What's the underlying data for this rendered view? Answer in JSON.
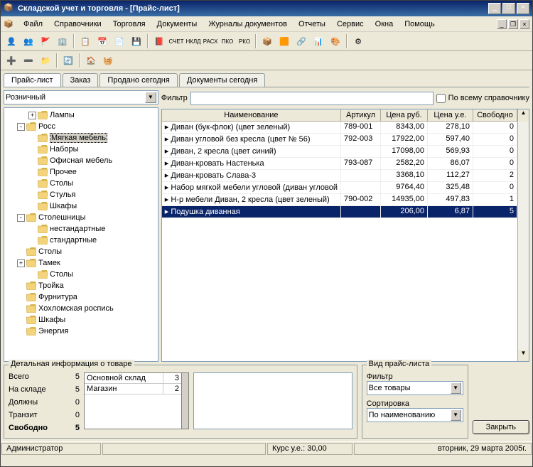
{
  "window": {
    "title": "Складской учет и торговля - [Прайс-лист]"
  },
  "menu": [
    "Файл",
    "Справочники",
    "Торговля",
    "Документы",
    "Журналы документов",
    "Отчеты",
    "Сервис",
    "Окна",
    "Помощь"
  ],
  "tabs": [
    {
      "label": "Прайс-лист",
      "active": true
    },
    {
      "label": "Заказ",
      "active": false
    },
    {
      "label": "Продано сегодня",
      "active": false
    },
    {
      "label": "Документы сегодня",
      "active": false
    }
  ],
  "price_type": "Розничный",
  "filter": {
    "label": "Фильтр",
    "value": "",
    "all_label": "По всему справочнику",
    "all_checked": false
  },
  "tree": [
    {
      "level": 2,
      "label": "Лампы",
      "toggle": "+"
    },
    {
      "level": 1,
      "label": "Росс",
      "toggle": "-"
    },
    {
      "level": 2,
      "label": "Мягкая мебель",
      "selected": true
    },
    {
      "level": 2,
      "label": "Наборы"
    },
    {
      "level": 2,
      "label": "Офисная мебель"
    },
    {
      "level": 2,
      "label": "Прочее"
    },
    {
      "level": 2,
      "label": "Столы"
    },
    {
      "level": 2,
      "label": "Стулья"
    },
    {
      "level": 2,
      "label": "Шкафы"
    },
    {
      "level": 1,
      "label": "Столешницы",
      "toggle": "-"
    },
    {
      "level": 2,
      "label": "нестандартные"
    },
    {
      "level": 2,
      "label": "стандартные"
    },
    {
      "level": 1,
      "label": "Столы"
    },
    {
      "level": 1,
      "label": "Тамек",
      "toggle": "+"
    },
    {
      "level": 2,
      "label": "Столы"
    },
    {
      "level": 1,
      "label": "Тройка"
    },
    {
      "level": 1,
      "label": "Фурнитура"
    },
    {
      "level": 1,
      "label": "Хохломская роспись"
    },
    {
      "level": 1,
      "label": "Шкафы"
    },
    {
      "level": 1,
      "label": "Энергия"
    }
  ],
  "grid": {
    "columns": [
      "Наименование",
      "Артикул",
      "Цена руб.",
      "Цена у.е.",
      "Свободно"
    ],
    "rows": [
      {
        "name": "Диван (бук-флок) (цвет зеленый)",
        "art": "789-001",
        "price": "8343,00",
        "priceu": "278,10",
        "free": "0"
      },
      {
        "name": "Диван угловой без кресла (цвет № 56)",
        "art": "792-003",
        "price": "17922,00",
        "priceu": "597,40",
        "free": "0"
      },
      {
        "name": "Диван, 2 кресла (цвет синий)",
        "art": "",
        "price": "17098,00",
        "priceu": "569,93",
        "free": "0"
      },
      {
        "name": "Диван-кровать Настенька",
        "art": "793-087",
        "price": "2582,20",
        "priceu": "86,07",
        "free": "0"
      },
      {
        "name": "Диван-кровать Слава-3",
        "art": "",
        "price": "3368,10",
        "priceu": "112,27",
        "free": "2"
      },
      {
        "name": "Набор мягкой мебели угловой (диван угловой",
        "art": "",
        "price": "9764,40",
        "priceu": "325,48",
        "free": "0"
      },
      {
        "name": "Н-р мебели Диван, 2 кресла (цвет зеленый)",
        "art": "790-002",
        "price": "14935,00",
        "priceu": "497,83",
        "free": "1"
      },
      {
        "name": "Подушка диванная",
        "art": "",
        "price": "206,00",
        "priceu": "6,87",
        "free": "5",
        "selected": true
      }
    ]
  },
  "detail": {
    "legend": "Детальная информация о товаре",
    "rows": [
      {
        "label": "Всего",
        "value": "5"
      },
      {
        "label": "На складе",
        "value": "5"
      },
      {
        "label": "Должны",
        "value": "0"
      },
      {
        "label": "Транзит",
        "value": "0"
      },
      {
        "label": "Свободно",
        "value": "5",
        "bold": true
      }
    ],
    "stock": [
      {
        "name": "Основной склад",
        "qty": "3"
      },
      {
        "name": "Магазин",
        "qty": "2"
      }
    ]
  },
  "pricelist_view": {
    "legend": "Вид прайс-листа",
    "filter_label": "Фильтр",
    "filter_value": "Все товары",
    "sort_label": "Сортировка",
    "sort_value": "По наименованию"
  },
  "close_button": "Закрыть",
  "statusbar": {
    "user": "Администратор",
    "rate": "Курс у.е.: 30,00",
    "date": "вторник, 29 марта 2005г."
  }
}
